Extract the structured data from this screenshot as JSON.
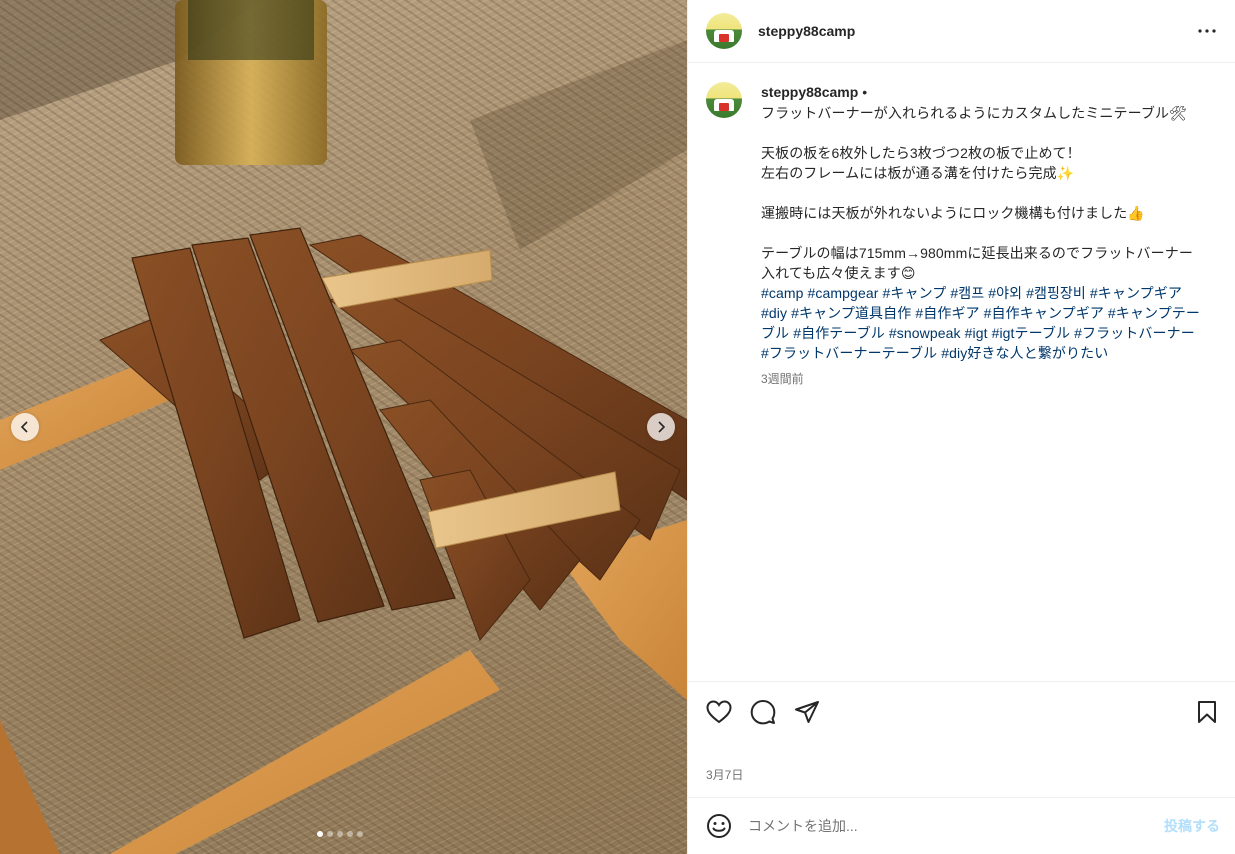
{
  "post": {
    "username": "steppy88camp",
    "more_icon": "more-horizontal-icon"
  },
  "caption": {
    "username": "steppy88camp",
    "separator": "•",
    "text": "フラットバーナーが入れられるようにカスタムしたミニテーブル🛠\n\n天板の板を6枚外したら3枚づつ2枚の板で止めて！\n左右のフレームには板が通る溝を付けたら完成✨\n\n運搬時には天板が外れないようにロック機構も付けました👍\n\nテーブルの幅は715mm→980mmに延長出来るのでフラットバーナー入れても広々使えます😊\n",
    "hashtags": [
      "#camp",
      "#campgear",
      "#キャンプ",
      "#캠프",
      "#야외",
      "#캠핑장비",
      "#キャンプギア",
      "#diy",
      "#キャンプ道具自作",
      "#自作ギア",
      "#自作キャンプギア",
      "#キャンプテーブル",
      "#自作テーブル",
      "#snowpeak",
      "#igt",
      "#igtテーブル",
      "#フラットバーナー",
      "#フラットバーナーテーブル",
      "#diy好きな人と繋がりたい"
    ],
    "time": "3週間前"
  },
  "carousel": {
    "slide_count": 5,
    "active_index": 0
  },
  "actions": {
    "like_icon": "heart-icon",
    "comment_icon": "comment-icon",
    "share_icon": "share-icon",
    "save_icon": "bookmark-icon"
  },
  "date": "3月7日",
  "comment_box": {
    "placeholder": "コメントを追加...",
    "post_label": "投稿する",
    "emoji_icon": "emoji-icon"
  },
  "colors": {
    "link": "#00376b",
    "muted": "#737373",
    "post_button": "#b2dffc",
    "border": "#efefef"
  }
}
